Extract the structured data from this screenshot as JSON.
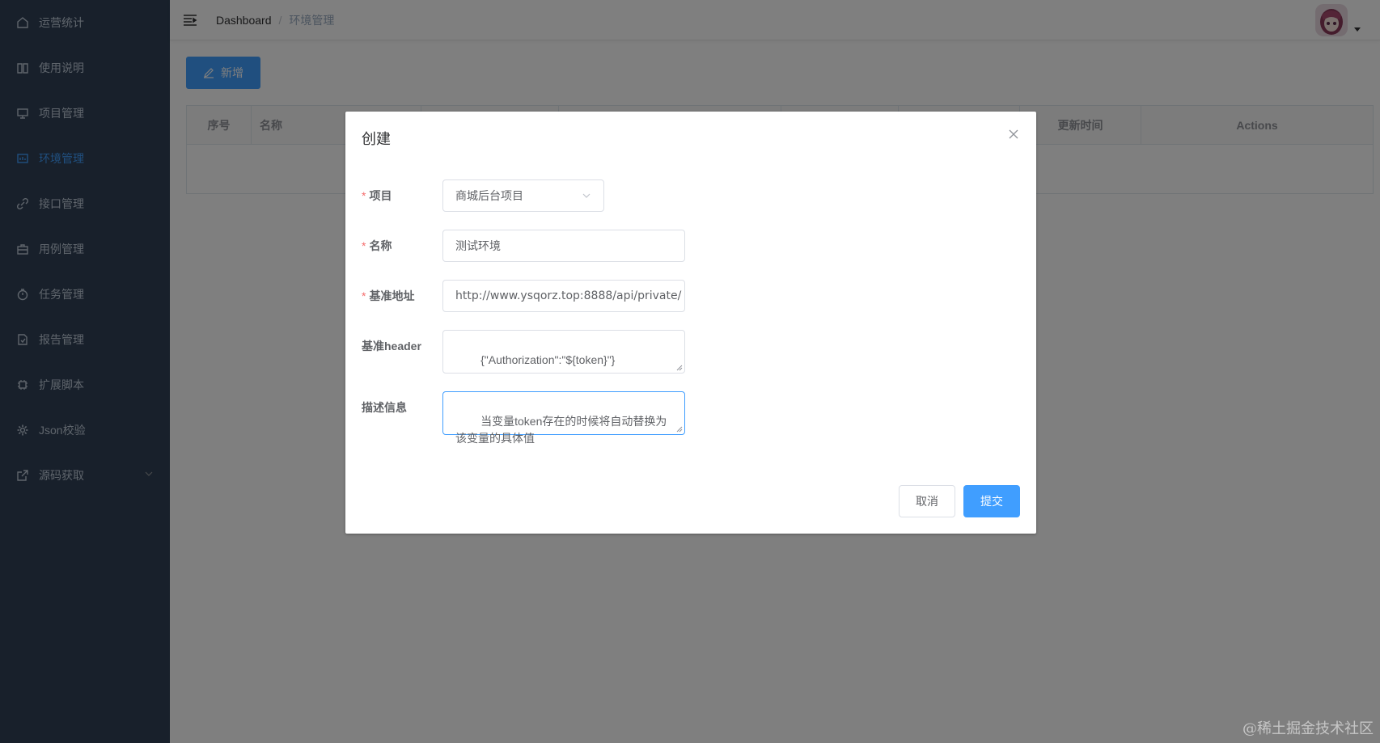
{
  "sidebar": {
    "items": [
      {
        "label": "运营统计",
        "icon": "home-icon"
      },
      {
        "label": "使用说明",
        "icon": "book-icon"
      },
      {
        "label": "项目管理",
        "icon": "monitor-icon"
      },
      {
        "label": "环境管理",
        "icon": "env-icon",
        "active": true
      },
      {
        "label": "接口管理",
        "icon": "link-icon"
      },
      {
        "label": "用例管理",
        "icon": "briefcase-icon"
      },
      {
        "label": "任务管理",
        "icon": "timer-icon"
      },
      {
        "label": "报告管理",
        "icon": "document-icon"
      },
      {
        "label": "扩展脚本",
        "icon": "cpu-icon"
      },
      {
        "label": "Json校验",
        "icon": "gear-icon"
      },
      {
        "label": "源码获取",
        "icon": "external-link-icon",
        "has_submenu": true
      }
    ]
  },
  "navbar": {
    "breadcrumb": {
      "home": "Dashboard",
      "separator": "/",
      "current": "环境管理"
    }
  },
  "toolbar": {
    "add_label": "新增"
  },
  "table": {
    "columns": [
      "序号",
      "名称",
      "",
      "",
      "",
      "",
      "更新时间",
      "Actions"
    ],
    "rows": []
  },
  "dialog": {
    "title": "创建",
    "fields": {
      "project": {
        "label": "项目",
        "required": true,
        "value": "商城后台项目"
      },
      "name": {
        "label": "名称",
        "required": true,
        "value": "测试环境"
      },
      "base_url": {
        "label": "基准地址",
        "required": true,
        "value": "http://www.ysqorz.top:8888/api/private/"
      },
      "base_header": {
        "label": "基准header",
        "required": false,
        "value": "{\"Authorization\":\"${token}\"}"
      },
      "description": {
        "label": "描述信息",
        "required": false,
        "value": "当变量token存在的时候将自动替换为该变量的具体值"
      }
    },
    "cancel_label": "取消",
    "submit_label": "提交"
  },
  "watermark": "@稀土掘金技术社区",
  "colors": {
    "sidebar_bg": "#304156",
    "sidebar_text": "#bfcbd9",
    "accent": "#409eff",
    "required": "#f56c6c"
  }
}
